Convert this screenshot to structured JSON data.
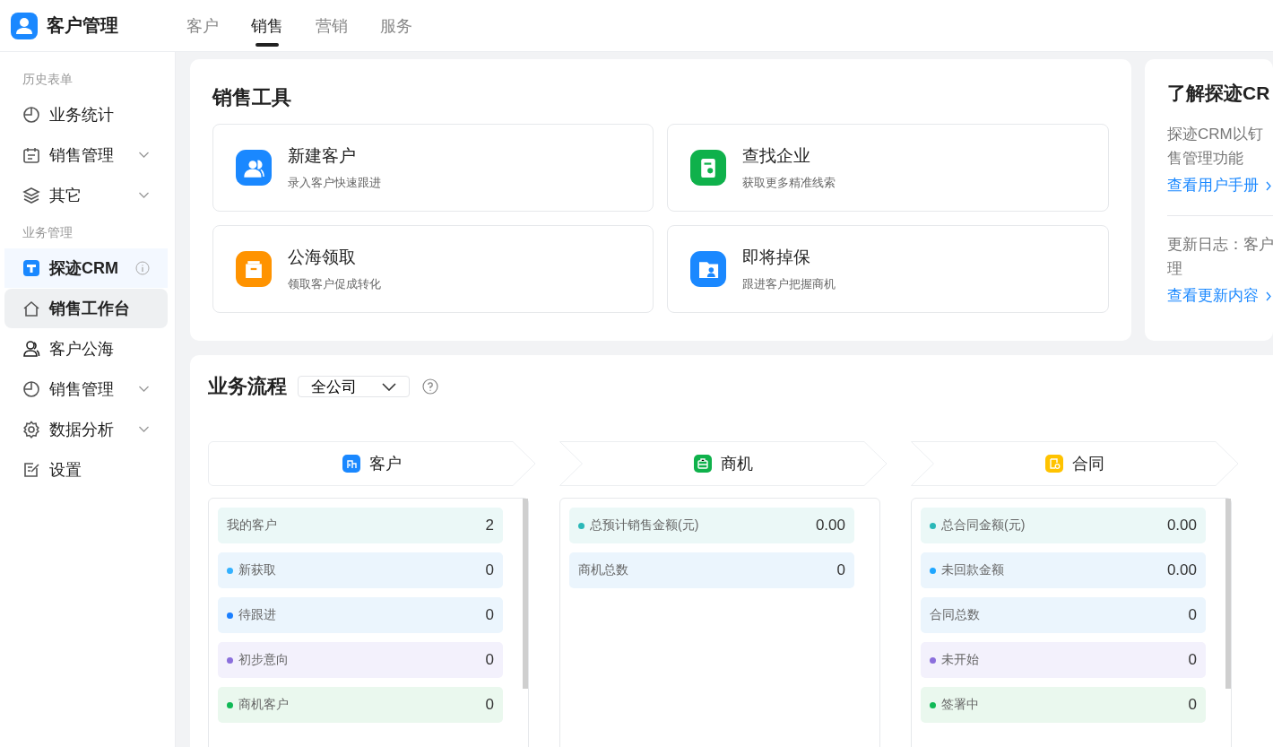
{
  "app": {
    "title": "客户管理"
  },
  "tabs": [
    {
      "label": "客户",
      "selected": false
    },
    {
      "label": "销售",
      "selected": true
    },
    {
      "label": "营销",
      "selected": false
    },
    {
      "label": "服务",
      "selected": false
    }
  ],
  "sidebar": {
    "sections": [
      {
        "title": "历史表单",
        "items": [
          {
            "label": "业务统计",
            "kind": "plain",
            "selected": false
          },
          {
            "label": "销售管理",
            "kind": "group",
            "expanded": false,
            "selected": false
          },
          {
            "label": "其它",
            "kind": "group",
            "expanded": false,
            "selected": false
          }
        ]
      },
      {
        "title": "业务管理",
        "items": [
          {
            "label": "探迹CRM",
            "kind": "app"
          },
          {
            "label": "销售工作台",
            "kind": "plain",
            "selected": true
          },
          {
            "label": "客户公海",
            "kind": "plain",
            "selected": false
          },
          {
            "label": "销售管理",
            "kind": "group",
            "expanded": false,
            "selected": false
          },
          {
            "label": "数据分析",
            "kind": "group",
            "expanded": false,
            "selected": false
          },
          {
            "label": "设置",
            "kind": "plain",
            "selected": false
          }
        ]
      }
    ]
  },
  "sales_tools": {
    "title": "销售工具",
    "tools": [
      {
        "title": "新建客户",
        "subtitle": "录入客户快速跟进",
        "color": "#1a88ff"
      },
      {
        "title": "查找企业",
        "subtitle": "获取更多精准线索",
        "color": "#0fb14b"
      },
      {
        "title": "公海领取",
        "subtitle": "领取客户促成转化",
        "color": "#ff9300"
      },
      {
        "title": "即将掉保",
        "subtitle": "跟进客户把握商机",
        "color": "#1a88ff"
      }
    ]
  },
  "about": {
    "title": "了解探迹CR",
    "lines": [
      "探迹CRM以钉",
      "售管理功能"
    ],
    "link1": "查看用户手册",
    "log_lines": [
      "更新日志：客户",
      "理"
    ],
    "link2": "查看更新内容"
  },
  "flow": {
    "title": "业务流程",
    "scope": "全公司",
    "stages": [
      {
        "name": "客户",
        "color": "#1a88ff",
        "rows": [
          {
            "label": "我的客户",
            "value": "2",
            "color": "#ebf8f7"
          },
          {
            "label": "新获取",
            "value": "0",
            "color": "#ebf5fd",
            "dot": {
              "color": "#33b1ff"
            }
          },
          {
            "label": "待跟进",
            "value": "0",
            "color": "#ebf5fd",
            "dot": {
              "color": "#1a7fff"
            }
          },
          {
            "label": "初步意向",
            "value": "0",
            "color": "#f3f1fc",
            "dot": {
              "color": "#8b6fdc"
            }
          },
          {
            "label": "商机客户",
            "value": "0",
            "color": "#eaf8ee",
            "dot": {
              "color": "#10b956"
            }
          }
        ]
      },
      {
        "name": "商机",
        "color": "#0fb14b",
        "rows": [
          {
            "label": "总预计销售金额(元)",
            "value": "0.00",
            "color": "#ebf8f7",
            "dot": {
              "color": "#2bb8b8"
            }
          },
          {
            "label": "商机总数",
            "value": "0",
            "color": "#ebf5fd"
          }
        ]
      },
      {
        "name": "合同",
        "color": "#ffc300",
        "rows": [
          {
            "label": "总合同金额(元)",
            "value": "0.00",
            "color": "#ebf8f7",
            "dot": {
              "color": "#2bb8b8"
            }
          },
          {
            "label": "未回款金额",
            "value": "0.00",
            "color": "#ebf5fd",
            "dot": {
              "color": "#1fa6ff"
            }
          },
          {
            "label": "合同总数",
            "value": "0",
            "color": "#ebf5fd"
          },
          {
            "label": "未开始",
            "value": "0",
            "color": "#f3f1fc",
            "dot": {
              "color": "#8b6fdc"
            }
          },
          {
            "label": "签署中",
            "value": "0",
            "color": "#eaf8ee",
            "dot": {
              "color": "#10b956"
            }
          }
        ]
      }
    ]
  }
}
